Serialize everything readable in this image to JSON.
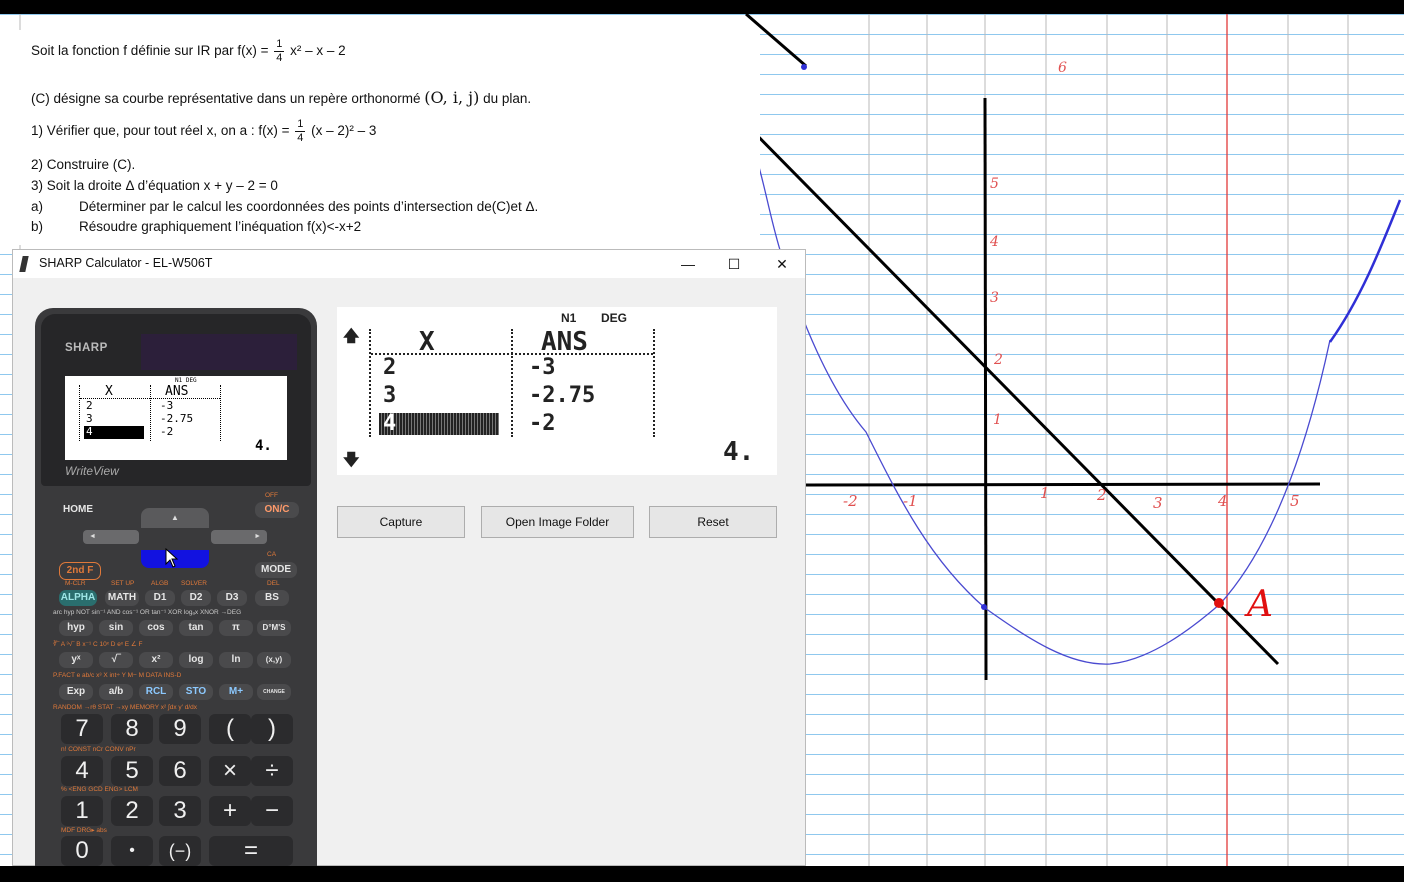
{
  "exercise": {
    "line1_prefix": "Soit la fonction f définie sur IR par f(x) =",
    "frac_one": "1",
    "frac_four": "4",
    "line1_suffix": "x² – x – 2",
    "line2": "(C) désigne sa courbe représentative dans un repère orthonormé",
    "line2_repere": "(O, i, j)",
    "line2_end": "du plan.",
    "line3_prefix": "1)  Vérifier que, pour tout réel x, on a : f(x) =",
    "line3_suffix": "(x – 2)² – 3",
    "line4": "2)  Construire (C).",
    "line5": "3)  Soit la droite Δ d’équation x + y – 2 = 0",
    "line6_label": "a)",
    "line6_text": "Déterminer par le calcul les coordonnées des points d’intersection de(C)et Δ.",
    "line7_label": "b)",
    "line7_text": "Résoudre graphiquement l’inéquation f(x)<-x+2"
  },
  "window": {
    "title": "SHARP Calculator - EL-W506T",
    "minimize": "—",
    "maximize": "☐",
    "close": "✕"
  },
  "calculator": {
    "brand": "SHARP",
    "writeview": "WriteView",
    "small_lcd": {
      "status": "N1   DEG",
      "col_x": "X",
      "col_ans": "ANS",
      "rows": [
        [
          "2",
          "-3"
        ],
        [
          "3",
          "-2.75"
        ],
        [
          "4",
          "-2"
        ]
      ],
      "bottom_value": "4."
    },
    "keys": {
      "home": "HOME",
      "on": "ON/C",
      "off": "OFF",
      "second": "2nd F",
      "mode": "MODE",
      "ca": "CA",
      "alpha": "ALPHA",
      "math": "MATH",
      "d1": "D1",
      "d2": "D2",
      "d3": "D3",
      "bs": "BS",
      "hyp": "hyp",
      "sin": "sin",
      "cos": "cos",
      "tan": "tan",
      "pi": "π",
      "dms": "D°M'S",
      "pow": "yˣ",
      "root": "√‾",
      "sq": "x²",
      "log": "log",
      "ln": "ln",
      "xy": "(x,y)",
      "exp": "Exp",
      "ab": "a/b",
      "rcl": "RCL",
      "sto": "STO",
      "mplus": "M+",
      "change": "CHANGE",
      "n7": "7",
      "n8": "8",
      "n9": "9",
      "lp": "(",
      "rp": ")",
      "n4": "4",
      "n5": "5",
      "n6": "6",
      "mul": "×",
      "div": "÷",
      "n1": "1",
      "n2": "2",
      "n3": "3",
      "add": "+",
      "sub": "−",
      "n0": "0",
      "dot": "•",
      "neg": "(−)",
      "eq": "="
    },
    "secondary": {
      "mclr": "M-CLR",
      "setup": "SET UP",
      "algb": "ALGB",
      "solver": "SOLVER",
      "del": "DEL",
      "row3": "arc hyp NOT  sin⁻¹ AND  cos⁻¹ OR  tan⁻¹ XOR  logₐx XNOR  →DEG",
      "row4": "∛‾  A   ³√‾   B   x⁻¹   C   10ˣ   D   eˣ   E   ∠   F",
      "row5": "P.FACT  e   ab/c   x³   X  int÷  Y   M−   M  DATA INS-D",
      "row6": "RANDOM    →rθ  STAT   →xy MEMORY  x²  ∫dx   y′   d/dx",
      "row7": "n!  CONST   nCr CONV   nPr",
      "row8": "%   <ENG   GCD ENG>   LCM",
      "row9": "MDF        DRG▸       abs"
    }
  },
  "big_screen": {
    "status_n1": "N1",
    "status_deg": "DEG",
    "col_x": "X",
    "col_ans": "ANS",
    "rows": [
      [
        "2",
        "-3"
      ],
      [
        "3",
        "-2.75"
      ],
      [
        "4",
        "-2"
      ]
    ],
    "value": "4.",
    "arrow_up": "🡅",
    "arrow_down": "🡇"
  },
  "buttons": {
    "capture": "Capture",
    "open_folder": "Open Image Folder",
    "reset": "Reset"
  },
  "graph": {
    "point_label": "A",
    "x_ticks": [
      "-2",
      "-1",
      "1",
      "2",
      "3",
      "4",
      "5"
    ],
    "y_ticks": [
      "6",
      "5",
      "4",
      "3",
      "2",
      "1"
    ]
  }
}
